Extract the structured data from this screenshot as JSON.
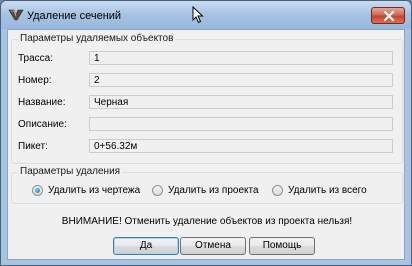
{
  "window": {
    "title": "Удаление сечений"
  },
  "params_group": {
    "legend": "Параметры удаляемых объектов",
    "fields": [
      {
        "label": "Трасса:",
        "value": "1"
      },
      {
        "label": "Номер:",
        "value": "2"
      },
      {
        "label": "Название:",
        "value": "Черная"
      },
      {
        "label": "Описание:",
        "value": ""
      },
      {
        "label": "Пикет:",
        "value": "0+56.32м"
      }
    ]
  },
  "delete_group": {
    "legend": "Параметры удаления",
    "options": [
      {
        "label": "Удалить из чертежа",
        "selected": true
      },
      {
        "label": "Удалить из проекта",
        "selected": false
      },
      {
        "label": "Удалить из всего",
        "selected": false
      }
    ]
  },
  "warning": "ВНИМАНИЕ! Отменить удаление объектов из проекта нельзя!",
  "buttons": {
    "ok": "Да",
    "cancel": "Отмена",
    "help": "Помощь"
  },
  "icons": {
    "app": "app-icon",
    "close": "close-icon",
    "cursor": "mouse-cursor-icon"
  }
}
